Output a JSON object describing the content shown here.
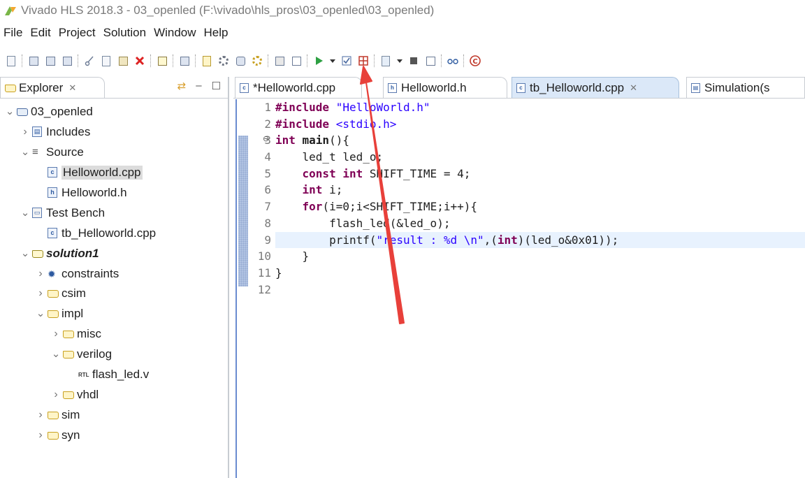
{
  "window": {
    "title": "Vivado HLS 2018.3 - 03_openled (F:\\vivado\\hls_pros\\03_openled\\03_openled)"
  },
  "menubar": {
    "items": [
      "File",
      "Edit",
      "Project",
      "Solution",
      "Window",
      "Help"
    ]
  },
  "toolbar": {
    "buttons": [
      "new-file",
      "save",
      "save-all",
      "save-as",
      "cut",
      "copy",
      "paste",
      "delete",
      "print",
      "layout",
      "new-solution",
      "settings",
      "open-project",
      "synthesis-settings",
      "export",
      "show-console",
      "run-c-simulation",
      "run-dropdown",
      "checkbox",
      "grid",
      "export-rtl",
      "export-dropdown",
      "stop",
      "compare",
      "analysis",
      "debug"
    ]
  },
  "explorer": {
    "tab_label": "Explorer",
    "close_glyph": "✕",
    "tree": [
      {
        "label": "03_openled",
        "level": 0,
        "expanded": true,
        "icon": "project-icon"
      },
      {
        "label": "Includes",
        "level": 1,
        "expanded": false,
        "icon": "includes-icon"
      },
      {
        "label": "Source",
        "level": 1,
        "expanded": true,
        "icon": "source-icon"
      },
      {
        "label": "Helloworld.cpp",
        "level": 2,
        "icon": "cpp-file-icon",
        "selected": true
      },
      {
        "label": "Helloworld.h",
        "level": 2,
        "icon": "h-file-icon"
      },
      {
        "label": "Test Bench",
        "level": 1,
        "expanded": true,
        "icon": "testbench-icon"
      },
      {
        "label": "tb_Helloworld.cpp",
        "level": 2,
        "icon": "cpp-file-icon"
      },
      {
        "label": "solution1",
        "level": 1,
        "expanded": true,
        "icon": "solution-icon",
        "bold": true
      },
      {
        "label": "constraints",
        "level": 2,
        "expanded": false,
        "icon": "constraints-icon"
      },
      {
        "label": "csim",
        "level": 2,
        "expanded": false,
        "icon": "folder-icon"
      },
      {
        "label": "impl",
        "level": 2,
        "expanded": true,
        "icon": "folder-icon"
      },
      {
        "label": "misc",
        "level": 3,
        "expanded": false,
        "icon": "folder-icon"
      },
      {
        "label": "verilog",
        "level": 3,
        "expanded": true,
        "icon": "folder-icon"
      },
      {
        "label": "flash_led.v",
        "level": 4,
        "icon": "rtl-file-icon"
      },
      {
        "label": "vhdl",
        "level": 3,
        "expanded": false,
        "icon": "folder-icon"
      },
      {
        "label": "sim",
        "level": 2,
        "expanded": false,
        "icon": "folder-icon"
      },
      {
        "label": "syn",
        "level": 2,
        "expanded": false,
        "icon": "folder-icon"
      }
    ]
  },
  "editor": {
    "tabs": [
      {
        "label": "*Helloworld.cpp",
        "active": false
      },
      {
        "label": "Helloworld.h",
        "active": false
      },
      {
        "label": "tb_Helloworld.cpp",
        "active": true,
        "closable": true
      },
      {
        "label": "Simulation(s",
        "active": false
      }
    ],
    "line_numbers": [
      "1",
      "2",
      "3",
      "4",
      "5",
      "6",
      "7",
      "8",
      "9",
      "10",
      "11",
      "12"
    ],
    "fold_marker": "⊖",
    "code_lines": [
      [
        {
          "t": "#include ",
          "c": "kw"
        },
        {
          "t": "\"HelloWorld.h\"",
          "c": "str"
        }
      ],
      [
        {
          "t": "#include ",
          "c": "kw"
        },
        {
          "t": "<stdio.h>",
          "c": "str"
        }
      ],
      [
        {
          "t": "int ",
          "c": "kw"
        },
        {
          "t": "main",
          "c": "bold"
        },
        {
          "t": "(){",
          "c": ""
        }
      ],
      [
        {
          "t": "    led_t led_o;",
          "c": "typ"
        }
      ],
      [
        {
          "t": "    ",
          "c": ""
        },
        {
          "t": "const int ",
          "c": "kw"
        },
        {
          "t": "SHIFT_TIME = 4;",
          "c": ""
        }
      ],
      [
        {
          "t": "    ",
          "c": ""
        },
        {
          "t": "int ",
          "c": "kw"
        },
        {
          "t": "i;",
          "c": ""
        }
      ],
      [
        {
          "t": "    ",
          "c": ""
        },
        {
          "t": "for",
          "c": "kw"
        },
        {
          "t": "(i=0;i<SHIFT_TIME;i++){",
          "c": ""
        }
      ],
      [
        {
          "t": "        flash_led(&led_o);",
          "c": ""
        }
      ],
      [
        {
          "t": "        printf(",
          "c": ""
        },
        {
          "t": "\"result : %d \\n\"",
          "c": "str"
        },
        {
          "t": ",(",
          "c": ""
        },
        {
          "t": "int",
          "c": "kw"
        },
        {
          "t": ")(led_o&0x01));",
          "c": ""
        }
      ],
      [
        {
          "t": "    }",
          "c": ""
        }
      ],
      [
        {
          "t": "}",
          "c": ""
        }
      ],
      [
        {
          "t": "",
          "c": ""
        }
      ]
    ],
    "highlighted_line": 9
  },
  "colors": {
    "keyword": "#7f0055",
    "string": "#2a00ff",
    "annotation_arrow": "#e8403a",
    "run_button": "#2ea043"
  }
}
